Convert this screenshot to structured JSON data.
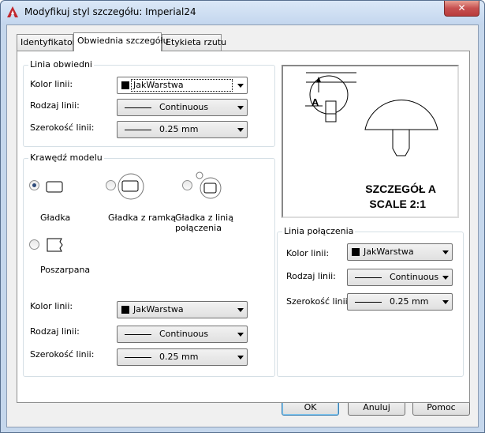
{
  "window": {
    "title": "Modyfikuj styl szczegółu: Imperial24",
    "close_label": "✕"
  },
  "tabs": [
    {
      "label": "Identyfikator"
    },
    {
      "label": "Obwiednia szczegółu",
      "active": true
    },
    {
      "label": "Etykieta rzutu"
    }
  ],
  "outline_group": {
    "title": "Linia obwiedni",
    "color_label": "Kolor linii:",
    "color_value": "JakWarstwa",
    "linetype_label": "Rodzaj linii:",
    "linetype_value": "Continuous",
    "lineweight_label": "Szerokość linii:",
    "lineweight_value": "0.25 mm"
  },
  "model_edge_group": {
    "title": "Krawędź modelu",
    "options": [
      {
        "label": "Gładka",
        "checked": true
      },
      {
        "label": "Gładka z ramką",
        "checked": false
      },
      {
        "label_line1": "Gładka z linią",
        "label_line2": "połączenia",
        "checked": false
      },
      {
        "label": "Poszarpana",
        "checked": false
      }
    ],
    "color_label": "Kolor linii:",
    "color_value": "JakWarstwa",
    "linetype_label": "Rodzaj linii:",
    "linetype_value": "Continuous",
    "lineweight_label": "Szerokość linii:",
    "lineweight_value": "0.25 mm"
  },
  "preview": {
    "callout_letter": "A",
    "line1": "SZCZEGÓŁ A",
    "line2": "SCALE 2:1"
  },
  "connection_group": {
    "title": "Linia połączenia",
    "color_label": "Kolor linii:",
    "color_value": "JakWarstwa",
    "linetype_label": "Rodzaj linii:",
    "linetype_value": "Continuous",
    "lineweight_label": "Szerokość linii:",
    "lineweight_value": "0.25 mm"
  },
  "buttons": {
    "ok": "OK",
    "cancel": "Anuluj",
    "help": "Pomoc"
  },
  "colors": {
    "accent": "#3c7fb1",
    "close_red": "#c75050",
    "frame": "#c5d7ec"
  }
}
